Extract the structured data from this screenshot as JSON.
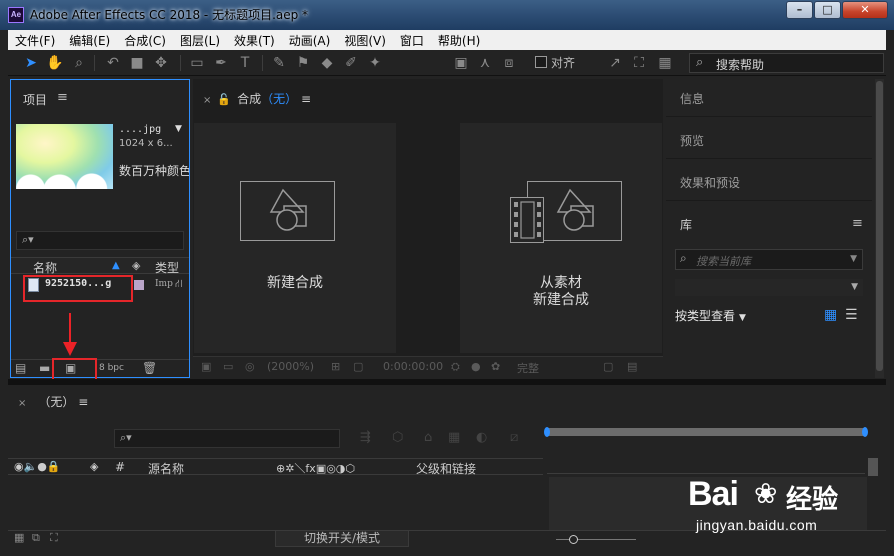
{
  "window": {
    "app_icon": "Ae",
    "title": "Adobe After Effects CC 2018 - 无标题项目.aep *",
    "min": "–",
    "max": "□",
    "close": "✕"
  },
  "menu": [
    "文件(F)",
    "编辑(E)",
    "合成(C)",
    "图层(L)",
    "效果(T)",
    "动画(A)",
    "视图(V)",
    "窗口",
    "帮助(H)"
  ],
  "toolbar": {
    "snap_label": "对齐",
    "search_placeholder": "搜索帮助",
    "accent": "#2e8fff"
  },
  "project": {
    "title": "项目",
    "menu_icon": "≡",
    "file_name": "....jpg",
    "file_dims": "1024 x 6...",
    "file_colors": "数百万种颜色",
    "search_icon": "⌕▾",
    "col_name": "名称",
    "col_type": "类型",
    "item_name": "9252150...g",
    "item_type": "Imp",
    "bpc": "8 bpc"
  },
  "comp": {
    "tab_label": "合成",
    "tab_value": "（无）",
    "new_comp": "新建合成",
    "from_footage_line1": "从素材",
    "from_footage_line2": "新建合成",
    "zoom": "(2000%)",
    "timecode": "0:00:00:00",
    "view": "完整"
  },
  "right": {
    "info": "信息",
    "preview": "预览",
    "effects": "效果和预设",
    "library": "库",
    "lib_search_placeholder": "搜索当前库",
    "view_by_type": "按类型查看"
  },
  "timeline": {
    "tab_label": "（无）",
    "search_icon": "⌕▾",
    "col_hash": "#",
    "col_source": "源名称",
    "col_parent": "父级和链接",
    "mode_toggle": "切换开关/模式"
  },
  "watermark": {
    "brand": "Bai",
    "brand_cn": "经验",
    "url": "jingyan.baidu.com"
  }
}
